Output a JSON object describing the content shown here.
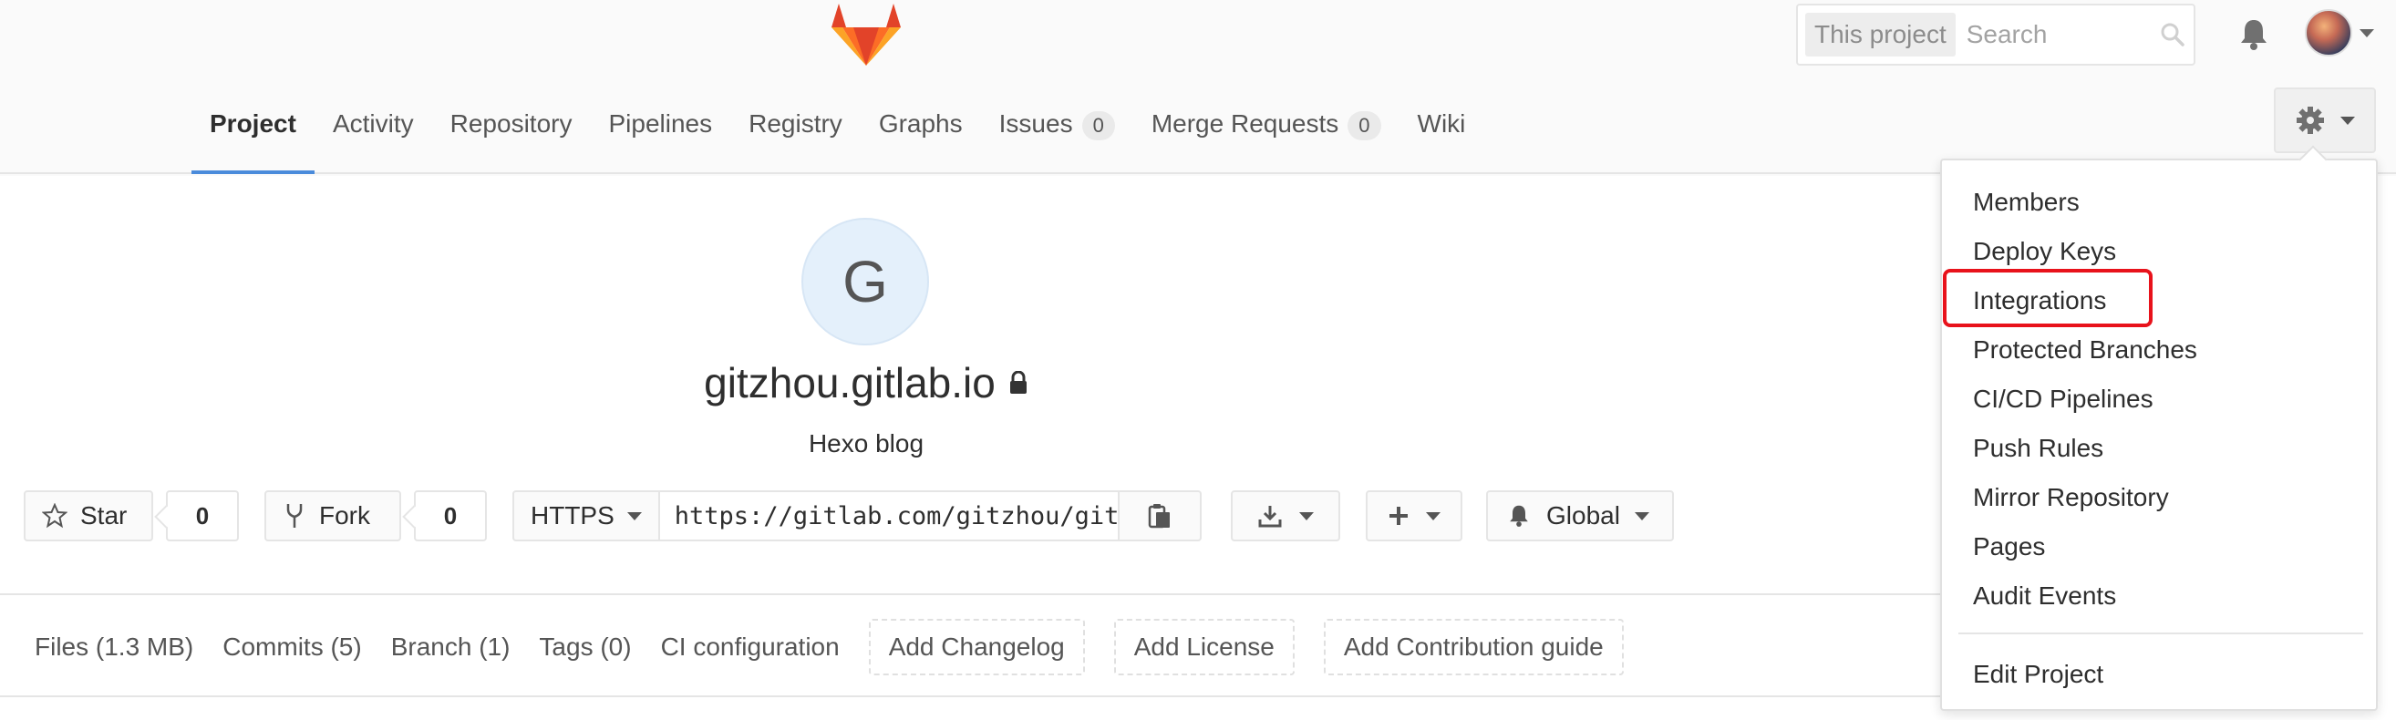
{
  "header": {
    "search": {
      "scope": "This project",
      "placeholder": "Search"
    },
    "nav_tabs": [
      {
        "label": "Project",
        "active": true
      },
      {
        "label": "Activity"
      },
      {
        "label": "Repository"
      },
      {
        "label": "Pipelines"
      },
      {
        "label": "Registry"
      },
      {
        "label": "Graphs"
      },
      {
        "label": "Issues",
        "count": "0"
      },
      {
        "label": "Merge Requests",
        "count": "0"
      },
      {
        "label": "Wiki"
      }
    ]
  },
  "project": {
    "avatar_letter": "G",
    "name": "gitzhou.gitlab.io",
    "description": "Hexo blog"
  },
  "actions": {
    "star_label": "Star",
    "star_count": "0",
    "fork_label": "Fork",
    "fork_count": "0",
    "clone_protocol": "HTTPS",
    "clone_url": "https://gitlab.com/gitzhou/gitzhou.gitlab.io.git",
    "notification_label": "Global"
  },
  "stats": {
    "files": "Files (1.3 MB)",
    "commits": "Commits (5)",
    "branch": "Branch (1)",
    "tags": "Tags (0)",
    "ci": "CI configuration",
    "add_changelog": "Add Changelog",
    "add_license": "Add License",
    "add_contribution": "Add Contribution guide"
  },
  "settings_menu": {
    "items": [
      "Members",
      "Deploy Keys",
      "Integrations",
      "Protected Branches",
      "CI/CD Pipelines",
      "Push Rules",
      "Mirror Repository",
      "Pages",
      "Audit Events"
    ],
    "edit_project": "Edit Project",
    "highlighted_item": "Integrations"
  },
  "colors": {
    "accent": "#4a8bdb",
    "highlight": "#e8121b",
    "logo_orange": "#fc6d26"
  }
}
